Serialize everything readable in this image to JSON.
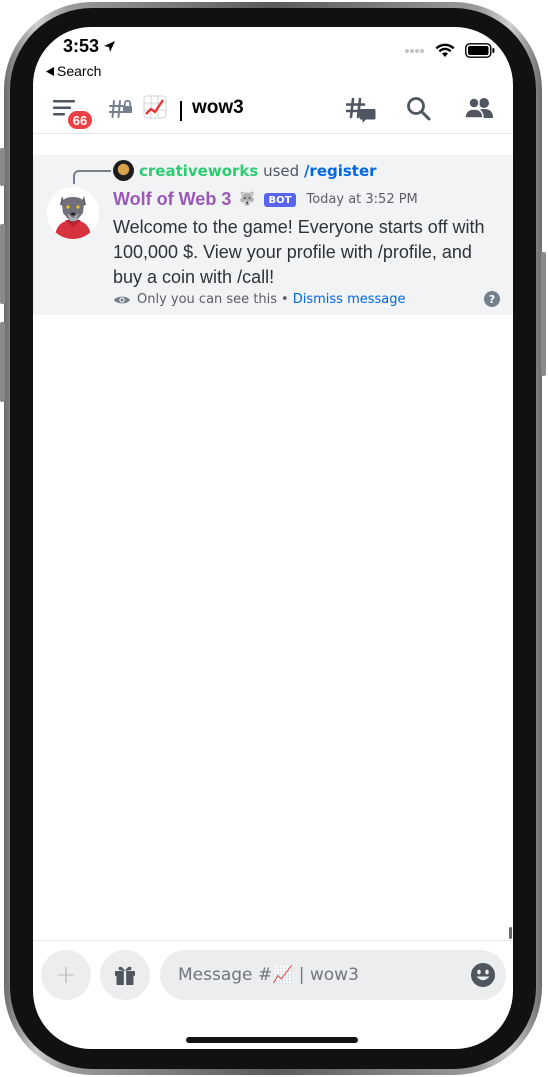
{
  "status": {
    "time": "3:53",
    "back_label": "Search"
  },
  "header": {
    "unread_badge": "66",
    "channel_emoji": "📈",
    "channel_name": "wow3",
    "icons": [
      "menu-icon",
      "locked-hash-icon",
      "threads-icon",
      "search-icon",
      "members-icon"
    ]
  },
  "message": {
    "reply": {
      "user": "creativeworks",
      "verb": "used",
      "command": "/register"
    },
    "author": "Wolf of Web 3",
    "author_emoji": "🐺",
    "bot_tag": "BOT",
    "timestamp": "Today at 3:52 PM",
    "body": "Welcome to the game! Everyone starts off with 100,000 $. View your profile with /profile, and buy a coin with /call!",
    "ephemeral_note": "Only you can see this",
    "separator": "•",
    "dismiss_label": "Dismiss message",
    "help_glyph": "?"
  },
  "composer": {
    "placeholder": "Message #📈 | wow3",
    "add_glyph": "+",
    "icons": [
      "plus-icon",
      "gift-icon",
      "emoji-icon"
    ]
  },
  "colors": {
    "author": "#9b59b6",
    "reply_user": "#2ecc71",
    "link": "#0068e0",
    "bot_tag": "#5865f2",
    "badge": "#ed4245",
    "message_bg": "#f2f3f5"
  }
}
